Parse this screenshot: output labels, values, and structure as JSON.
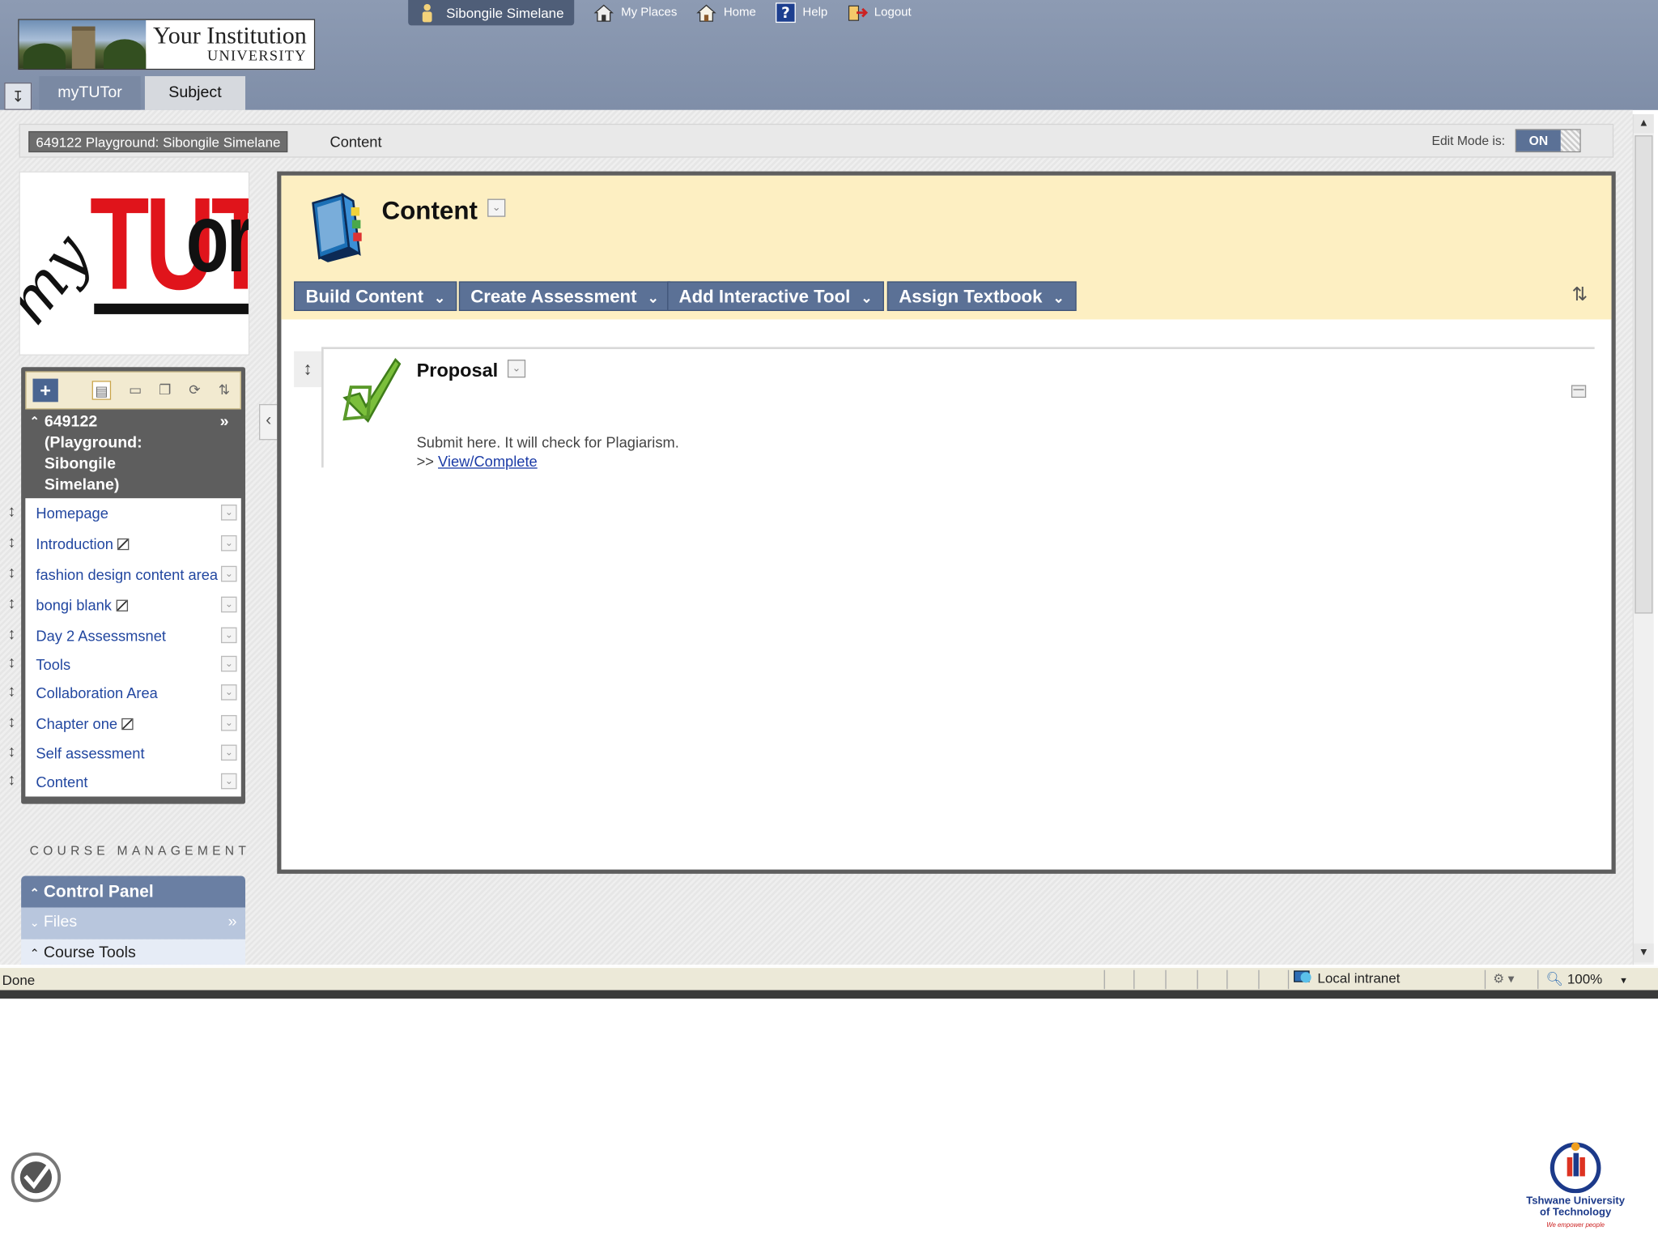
{
  "header": {
    "institution_title": "Your Institution",
    "institution_sub": "UNIVERSITY",
    "user_name": "Sibongile Simelane",
    "nav": {
      "my_places": "My Places",
      "home": "Home",
      "help": "Help",
      "logout": "Logout"
    }
  },
  "tabs": {
    "mytutor": "myTUTor",
    "subject": "Subject"
  },
  "breadcrumb": {
    "course": "649122 Playground: Sibongile Simelane",
    "page": "Content"
  },
  "edit_mode": {
    "label": "Edit Mode is:",
    "state": "ON"
  },
  "sidebar": {
    "logo_text_tut": "TUT",
    "logo_text_or": "or",
    "logo_text_my": "my",
    "course_title": "649122\n(Playground:\nSibongile\nSimelane)",
    "items": [
      {
        "label": "Homepage",
        "hidden": false
      },
      {
        "label": "Introduction",
        "hidden": true
      },
      {
        "label": "fashion design content area",
        "hidden": false
      },
      {
        "label": "bongi blank",
        "hidden": true
      },
      {
        "label": "Day 2 Assessmsnet",
        "hidden": false
      },
      {
        "label": "Tools",
        "hidden": false
      },
      {
        "label": "Collaboration Area",
        "hidden": false
      },
      {
        "label": "Chapter one",
        "hidden": true
      },
      {
        "label": "Self assessment",
        "hidden": false
      },
      {
        "label": "Content",
        "hidden": false
      }
    ],
    "course_management": "COURSE MANAGEMENT",
    "control_panel": "Control Panel",
    "files": "Files",
    "course_tools": "Course Tools"
  },
  "content": {
    "title": "Content",
    "actions": [
      "Build Content",
      "Create Assessment",
      "Add Interactive Tool",
      "Assign Textbook"
    ],
    "item": {
      "title": "Proposal",
      "description": "Submit here. It will check for Plagiarism.",
      "link_prefix": ">>",
      "link_label": "View/Complete"
    }
  },
  "statusbar": {
    "status": "Done",
    "zone": "Local intranet",
    "zoom": "100%"
  },
  "footer": {
    "tut_name": "Tshwane University of Technology",
    "tut_tagline": "We empower people"
  },
  "colors": {
    "header_bg": "#8a98b0",
    "action_button": "#5b7196",
    "content_header_bg": "#fdefc2",
    "link": "#2247a0",
    "logo_red": "#e0141b"
  }
}
